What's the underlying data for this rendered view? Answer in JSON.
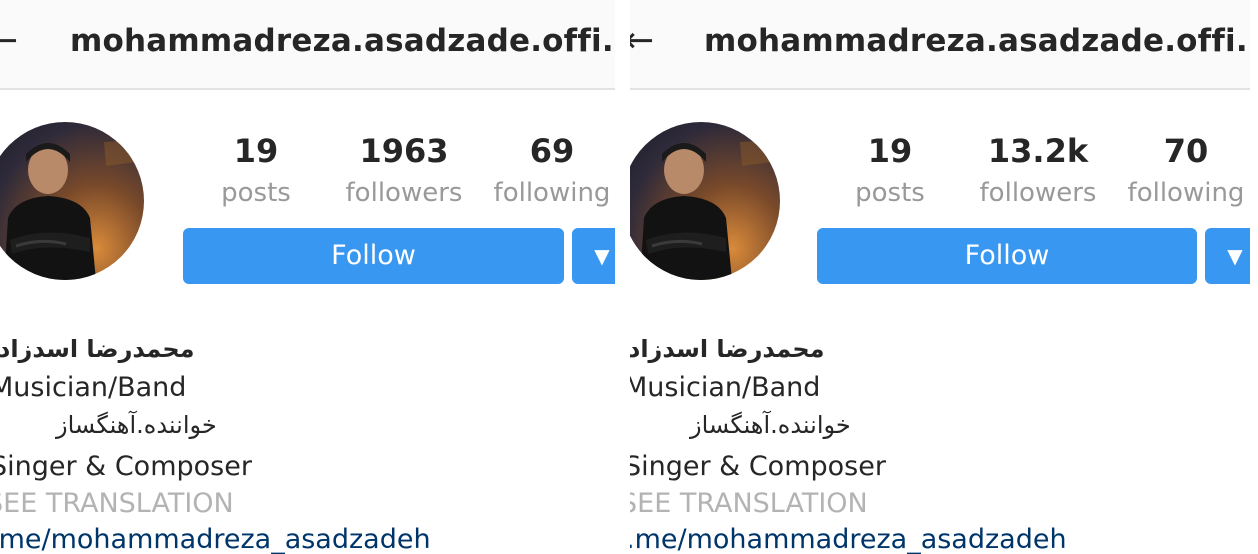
{
  "panels": [
    {
      "username": "mohammadreza.asadzade.offi...",
      "posts": "19",
      "posts_label": "posts",
      "followers": "1963",
      "followers_label": "followers",
      "following": "69",
      "following_label": "following",
      "follow_label": "Follow",
      "dropdown_icon": "▼",
      "back_icon": "←",
      "name_fa": "محمدرضا اسدزاد",
      "category": "Musician/Band",
      "bio_fa": "خواننده.آهنگساز",
      "bio_en": "Singer & Composer",
      "translation": "SEE TRANSLATION",
      "link": ".me/mohammadreza_asadzadeh"
    },
    {
      "username": "mohammadreza.asadzade.offi...",
      "posts": "19",
      "posts_label": "posts",
      "followers": "13.2k",
      "followers_label": "followers",
      "following": "70",
      "following_label": "following",
      "follow_label": "Follow",
      "dropdown_icon": "▼",
      "back_icon": "←",
      "name_fa": "محمدرضا اسدزاد",
      "category": "Musician/Band",
      "bio_fa": "خواننده.آهنگساز",
      "bio_en": "Singer & Composer",
      "translation": "SEE TRANSLATION",
      "link": ".me/mohammadreza_asadzadeh"
    }
  ],
  "colors": {
    "follow_button": "#3897f0",
    "link": "#003569",
    "muted": "#999999"
  }
}
